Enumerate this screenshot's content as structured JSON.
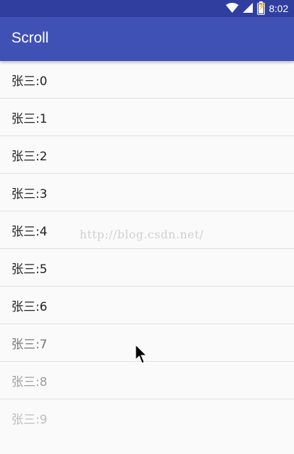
{
  "status_bar": {
    "time": "8:02",
    "battery_glyph": "⚡"
  },
  "app_bar": {
    "title": "Scroll"
  },
  "list": {
    "items": [
      {
        "label": "张三:0"
      },
      {
        "label": "张三:1"
      },
      {
        "label": "张三:2"
      },
      {
        "label": "张三:3"
      },
      {
        "label": "张三:4"
      },
      {
        "label": "张三:5"
      },
      {
        "label": "张三:6"
      },
      {
        "label": "张三:7"
      },
      {
        "label": "张三:8"
      },
      {
        "label": "张三:9"
      }
    ]
  },
  "watermark": "http://blog.csdn.net/",
  "colors": {
    "status_bar": "#303f9f",
    "app_bar": "#3f51b5",
    "background": "#fafafa"
  },
  "icons": [
    "wifi-icon",
    "signal-icon",
    "battery-icon",
    "cursor-icon"
  ]
}
